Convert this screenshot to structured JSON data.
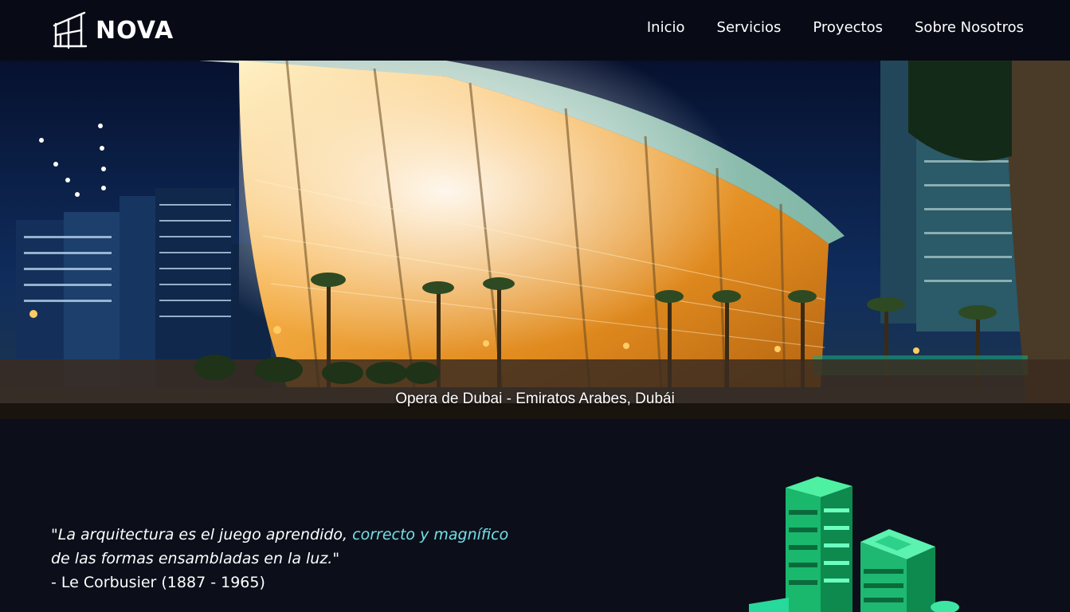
{
  "brand": {
    "name": "NOVA"
  },
  "nav": {
    "items": [
      {
        "label": "Inicio"
      },
      {
        "label": "Servicios"
      },
      {
        "label": "Proyectos"
      },
      {
        "label": "Sobre Nosotros"
      }
    ]
  },
  "hero": {
    "caption": "Opera de Dubai - Emiratos Arabes, Dubái"
  },
  "quote": {
    "part1": "\"La arquitectura es el juego aprendido, ",
    "highlight": "correcto y magnífico",
    "part2": "de las formas ensambladas en la luz.\"",
    "author": "- Le Corbusier (1887 - 1965)"
  },
  "colors": {
    "header_bg": "#080b16",
    "page_bg": "#0c0f1a",
    "accent": "#74e0e6",
    "building_green": "#22c977"
  }
}
